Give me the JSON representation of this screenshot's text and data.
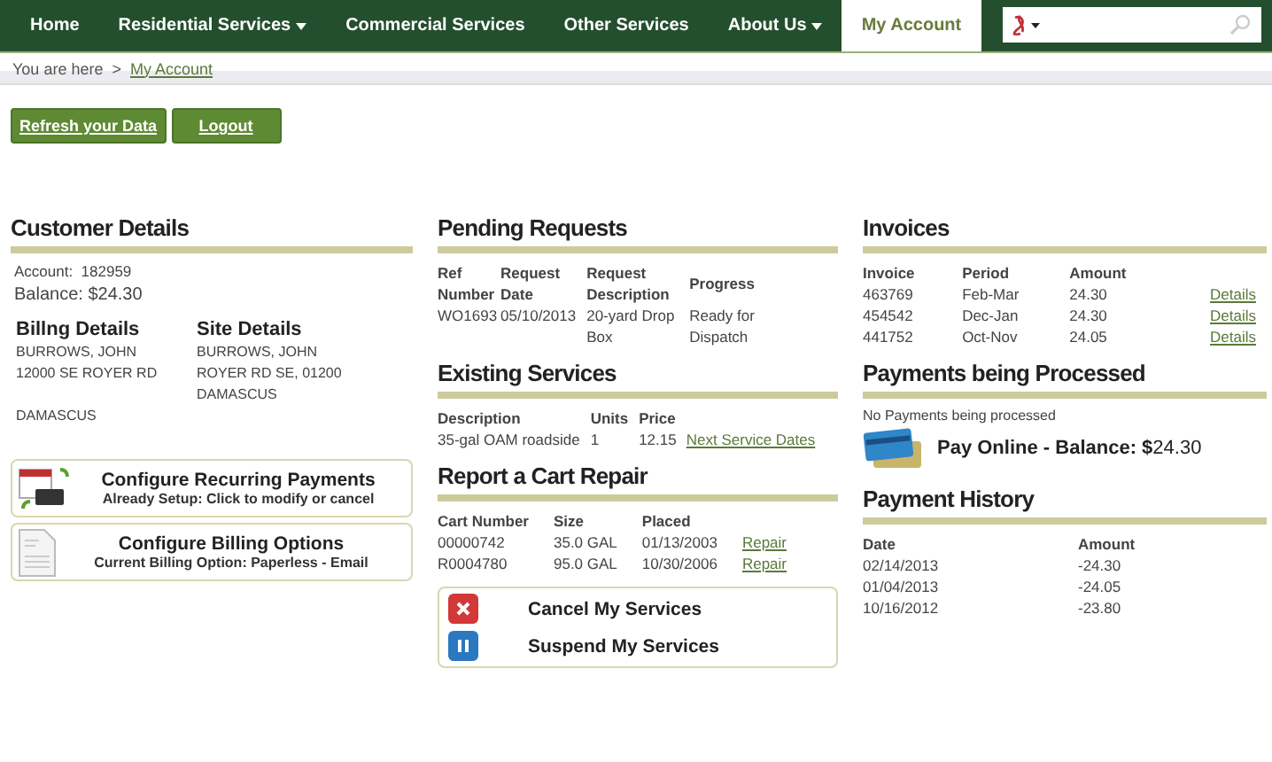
{
  "nav": {
    "items": [
      {
        "label": "Home",
        "selected": false,
        "has_menu": false
      },
      {
        "label": "Residential Services",
        "selected": false,
        "has_menu": true
      },
      {
        "label": "Commercial Services",
        "selected": false,
        "has_menu": false
      },
      {
        "label": "Other Services",
        "selected": false,
        "has_menu": false
      },
      {
        "label": "About Us",
        "selected": false,
        "has_menu": true
      },
      {
        "label": "My Account",
        "selected": true,
        "has_menu": false
      }
    ]
  },
  "breadcrumb": {
    "label": "You are here",
    "separator": ">",
    "link": "My Account"
  },
  "actions": [
    "Refresh your Data",
    "Logout"
  ],
  "customer_details": {
    "title": "Customer Details",
    "account_label": "Account:",
    "account": "182959",
    "balance_label": "Balance:",
    "balance": "$24.30",
    "billing": {
      "title": "Billng Details",
      "lines": [
        {
          "text": "BURROWS, JOHN",
          "gap_before": false
        },
        {
          "text": "12000 SE ROYER RD",
          "gap_before": false
        },
        {
          "text": "DAMASCUS",
          "gap_before": true
        }
      ]
    },
    "site": {
      "title": "Site Details",
      "lines": [
        "BURROWS, JOHN",
        "ROYER RD SE, 01200",
        "DAMASCUS"
      ]
    },
    "options": [
      {
        "kind": "recurring",
        "title": "Configure Recurring Payments",
        "subtitle": "Already Setup: Click to modify or cancel"
      },
      {
        "kind": "billing",
        "title": "Configure Billing Options",
        "subtitle": "Current Billing Option: Paperless - Email"
      }
    ]
  },
  "pending_requests": {
    "title": "Pending Requests",
    "columns": [
      "Ref Number",
      "Request Date",
      "Request Description",
      "Progress"
    ],
    "rows": [
      [
        "WO1693",
        "05/10/2013",
        "20-yard Drop Box",
        "Ready for Dispatch"
      ]
    ]
  },
  "existing_services": {
    "title": "Existing Services",
    "columns": [
      "Description",
      "Units",
      "Price"
    ],
    "rows": [
      {
        "description": "35-gal OAM roadside",
        "units": "1",
        "price": "12.15",
        "link": "Next Service Dates"
      }
    ]
  },
  "cart_repair": {
    "title": "Report a Cart Repair",
    "columns": [
      "Cart Number",
      "Size",
      "Placed"
    ],
    "rows": [
      {
        "cart": "00000742",
        "size": "35.0 GAL",
        "placed": "01/13/2003",
        "link": "Repair"
      },
      {
        "cart": "R0004780",
        "size": "95.0 GAL",
        "placed": "10/30/2006",
        "link": "Repair"
      }
    ],
    "service_actions": [
      {
        "kind": "cancel",
        "label": "Cancel My Services"
      },
      {
        "kind": "suspend",
        "label": "Suspend My Services"
      }
    ]
  },
  "invoices": {
    "title": "Invoices",
    "columns": [
      "Invoice",
      "Period",
      "Amount"
    ],
    "rows": [
      {
        "invoice": "463769",
        "period": "Feb-Mar",
        "amount": "24.30",
        "link": "Details"
      },
      {
        "invoice": "454542",
        "period": "Dec-Jan",
        "amount": "24.30",
        "link": "Details"
      },
      {
        "invoice": "441752",
        "period": "Oct-Nov",
        "amount": "24.05",
        "link": "Details"
      }
    ]
  },
  "payments_processing": {
    "title": "Payments being Processed",
    "message": "No Payments being processed",
    "pay_online": "**Pay Online - Balance: $**24.30"
  },
  "payment_history": {
    "title": "Payment History",
    "columns": [
      "Date",
      "Amount"
    ],
    "rows": [
      [
        "02/14/2013",
        "-24.30"
      ],
      [
        "01/04/2013",
        "-24.05"
      ],
      [
        "10/16/2012",
        "-23.80"
      ]
    ]
  }
}
